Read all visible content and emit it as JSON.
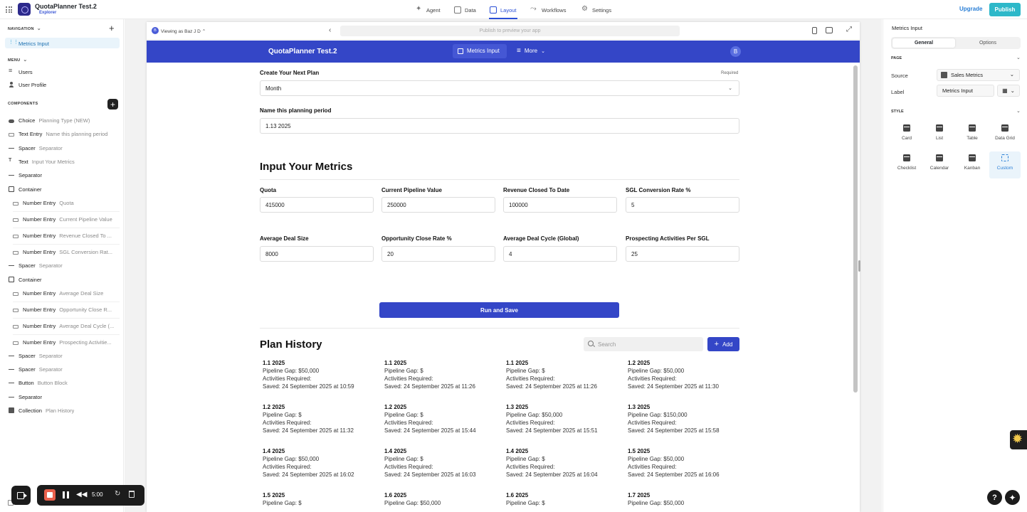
{
  "topbar": {
    "app_name": "QuotaPlanner Test.2",
    "app_sub": "Explorer",
    "nav": [
      {
        "label": "Agent",
        "icon": "sparkle-icon"
      },
      {
        "label": "Data",
        "icon": "table-icon"
      },
      {
        "label": "Layout",
        "icon": "layout-icon",
        "active": true
      },
      {
        "label": "Workflows",
        "icon": "workflow-icon"
      },
      {
        "label": "Settings",
        "icon": "gear-icon"
      }
    ],
    "upgrade": "Upgrade",
    "publish": "Publish",
    "accent": "#2a4fd6",
    "publish_color": "#2db8c9"
  },
  "left": {
    "navigation_head": "NAVIGATION",
    "nav_items": [
      "Metrics Input"
    ],
    "menu_head": "MENU",
    "menu_items": [
      "Users",
      "User Profile"
    ],
    "components_head": "COMPONENTS",
    "components": [
      {
        "type": "Choice",
        "name": "Planning Type (NEW)"
      },
      {
        "type": "Text Entry",
        "name": "Name this planning period"
      },
      {
        "type": "Spacer",
        "name": "Separator"
      },
      {
        "type": "Text",
        "name": "Input Your Metrics"
      },
      {
        "type": "Separator",
        "name": ""
      },
      {
        "type": "Container",
        "name": ""
      },
      {
        "type": "Number Entry",
        "name": "Quota"
      },
      {
        "type": "Number Entry",
        "name": "Current Pipeline Value"
      },
      {
        "type": "Number Entry",
        "name": "Revenue Closed To ..."
      },
      {
        "type": "Number Entry",
        "name": "SGL Conversion Rat..."
      },
      {
        "type": "Spacer",
        "name": "Separator"
      },
      {
        "type": "Container",
        "name": ""
      },
      {
        "type": "Number Entry",
        "name": "Average Deal Size"
      },
      {
        "type": "Number Entry",
        "name": "Opportunity Close R..."
      },
      {
        "type": "Number Entry",
        "name": "Average Deal Cycle (..."
      },
      {
        "type": "Number Entry",
        "name": "Prospecting Activitie..."
      },
      {
        "type": "Spacer",
        "name": "Separator"
      },
      {
        "type": "Spacer",
        "name": "Separator"
      },
      {
        "type": "Button",
        "name": "Button Block"
      },
      {
        "type": "Separator",
        "name": ""
      },
      {
        "type": "Collection",
        "name": "Plan History"
      }
    ]
  },
  "preview": {
    "viewing_avatar": "B",
    "viewing_as": "Viewing as Baz J D",
    "url_placeholder": "Publish to preview your app",
    "app_title": "QuotaPlanner Test.2",
    "tab_active": "Metrics Input",
    "tab_more": "More",
    "user_avatar": "B",
    "create_label": "Create Your Next Plan",
    "required": "Required",
    "plan_type_value": "Month",
    "name_label": "Name this planning period",
    "name_value": "1.13 2025",
    "metrics_heading": "Input Your Metrics",
    "metrics": [
      {
        "label": "Quota",
        "value": "415000"
      },
      {
        "label": "Current Pipeline Value",
        "value": "250000"
      },
      {
        "label": "Revenue Closed To Date",
        "value": "100000"
      },
      {
        "label": "SGL Conversion Rate %",
        "value": "5"
      },
      {
        "label": "Average Deal Size",
        "value": "8000"
      },
      {
        "label": "Opportunity Close Rate %",
        "value": "20"
      },
      {
        "label": "Average Deal Cycle (Global)",
        "value": "4"
      },
      {
        "label": "Prospecting Activities Per SGL",
        "value": "25"
      }
    ],
    "run_button": "Run and Save",
    "history_heading": "Plan History",
    "search_placeholder": "Search",
    "add_button": "Add",
    "plans": [
      {
        "title": "1.1 2025",
        "gap": "Pipeline Gap: $50,000",
        "activities": "Activities Required:",
        "saved": "Saved: 24 September 2025 at 10:59"
      },
      {
        "title": "1.1 2025",
        "gap": "Pipeline Gap: $",
        "activities": "Activities Required:",
        "saved": "Saved: 24 September 2025 at 11:26"
      },
      {
        "title": "1.1 2025",
        "gap": "Pipeline Gap: $",
        "activities": "Activities Required:",
        "saved": "Saved: 24 September 2025 at 11:26"
      },
      {
        "title": "1.2 2025",
        "gap": "Pipeline Gap: $50,000",
        "activities": "Activities Required:",
        "saved": "Saved: 24 September 2025 at 11:30"
      },
      {
        "title": "1.2 2025",
        "gap": "Pipeline Gap: $",
        "activities": "Activities Required:",
        "saved": "Saved: 24 September 2025 at 11:32"
      },
      {
        "title": "1.2 2025",
        "gap": "Pipeline Gap: $",
        "activities": "Activities Required:",
        "saved": "Saved: 24 September 2025 at 15:44"
      },
      {
        "title": "1.3 2025",
        "gap": "Pipeline Gap: $50,000",
        "activities": "Activities Required:",
        "saved": "Saved: 24 September 2025 at 15:51"
      },
      {
        "title": "1.3 2025",
        "gap": "Pipeline Gap: $150,000",
        "activities": "Activities Required:",
        "saved": "Saved: 24 September 2025 at 15:58"
      },
      {
        "title": "1.4 2025",
        "gap": "Pipeline Gap: $50,000",
        "activities": "Activities Required:",
        "saved": "Saved: 24 September 2025 at 16:02"
      },
      {
        "title": "1.4 2025",
        "gap": "Pipeline Gap: $",
        "activities": "Activities Required:",
        "saved": "Saved: 24 September 2025 at 16:03"
      },
      {
        "title": "1.4 2025",
        "gap": "Pipeline Gap: $",
        "activities": "Activities Required:",
        "saved": "Saved: 24 September 2025 at 16:04"
      },
      {
        "title": "1.5 2025",
        "gap": "Pipeline Gap: $50,000",
        "activities": "Activities Required:",
        "saved": "Saved: 24 September 2025 at 16:06"
      },
      {
        "title": "1.5 2025",
        "gap": "Pipeline Gap: $",
        "activities": "",
        "saved": ""
      },
      {
        "title": "1.6 2025",
        "gap": "Pipeline Gap: $50,000",
        "activities": "",
        "saved": ""
      },
      {
        "title": "1.6 2025",
        "gap": "Pipeline Gap: $",
        "activities": "",
        "saved": ""
      },
      {
        "title": "1.7 2025",
        "gap": "Pipeline Gap: $50,000",
        "activities": "",
        "saved": ""
      }
    ],
    "header_color": "#3446c7"
  },
  "right": {
    "title": "Metrics Input",
    "tabs": [
      "General",
      "Options"
    ],
    "page_head": "PAGE",
    "source_label": "Source",
    "source_value": "Sales Metrics",
    "label_label": "Label",
    "label_value": "Metrics Input",
    "style_head": "STYLE",
    "styles": [
      "Card",
      "List",
      "Table",
      "Data Grid",
      "Checklist",
      "Calendar",
      "Kanban",
      "Custom"
    ],
    "selected_style": "Custom"
  },
  "recorder": {
    "time": "5:00"
  }
}
